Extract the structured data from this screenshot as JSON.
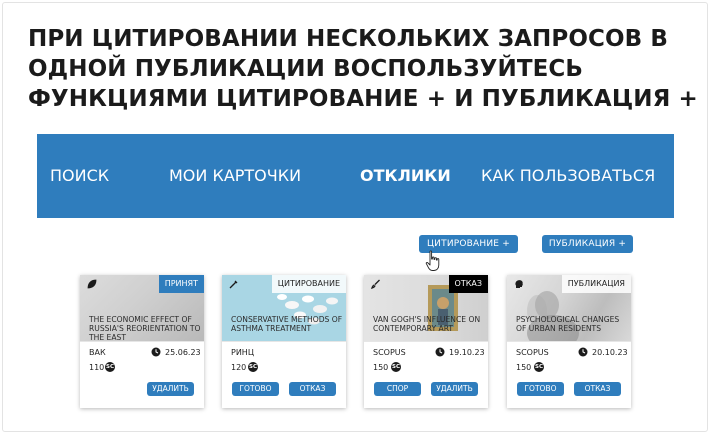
{
  "headline": {
    "line1": "ПРИ ЦИТИРОВАНИИ НЕСКОЛЬКИХ ЗАПРОСОВ В",
    "line2": "ОДНОЙ ПУБЛИКАЦИИ ВОСПОЛЬЗУЙТЕСЬ",
    "line3": "ФУНКЦИЯМИ ЦИТИРОВАНИЕ + И ПУБЛИКАЦИЯ +"
  },
  "nav": {
    "search": "ПОИСК",
    "my_cards": "МОИ КАРТОЧКИ",
    "responses": "ОТКЛИКИ",
    "how_to": "КАК ПОЛЬЗОВАТЬСЯ",
    "active": "ОТКЛИКИ"
  },
  "actions": {
    "citation_plus": "ЦИТИРОВАНИЕ +",
    "publication_plus": "ПУБЛИКАЦИЯ +"
  },
  "colors": {
    "accent": "#2f7dbd",
    "tag_accepted_bg": "#2f7dbd",
    "tag_refused_bg": "#000000"
  },
  "cards": [
    {
      "icon": "leaf-icon",
      "tag": "ПРИНЯТ",
      "title": "THE ECONOMIC EFFECT OF RUSSIA'S REORIENTATION TO THE EAST",
      "source": "ВАК",
      "date": "25.06.23",
      "price": "110",
      "coin": "SC",
      "buttons": [
        "УДАЛИТЬ"
      ]
    },
    {
      "icon": "syringe-icon",
      "tag": "ЦИТИРОВАНИЕ",
      "title": "CONSERVATIVE METHODS OF ASTHMA TREATMENT",
      "source": "РИНЦ",
      "date": "",
      "price": "120",
      "coin": "SC",
      "buttons": [
        "ГОТОВО",
        "ОТКАЗ"
      ]
    },
    {
      "icon": "brush-icon",
      "tag": "ОТКАЗ",
      "title": "VAN GOGH'S INFLUENCE ON CONTEMPORARY ART",
      "source": "SCOPUS",
      "date": "19.10.23",
      "price": "150",
      "coin": "SC",
      "buttons": [
        "СПОР",
        "УДАЛИТЬ"
      ]
    },
    {
      "icon": "head-icon",
      "tag": "ПУБЛИКАЦИЯ",
      "title": "PSYCHOLOGICAL CHANGES OF URBAN RESIDENTS",
      "source": "SCOPUS",
      "date": "20.10.23",
      "price": "150",
      "coin": "SC",
      "buttons": [
        "ГОТОВО",
        "ОТКАЗ"
      ]
    }
  ]
}
